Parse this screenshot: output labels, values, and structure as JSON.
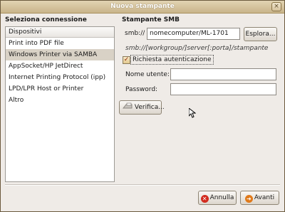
{
  "window": {
    "title": "Nuova stampante",
    "close_glyph": "×"
  },
  "left": {
    "heading": "Seleziona connessione",
    "list_header": "Dispositivi",
    "items": [
      "Print into PDF file",
      "Windows Printer via SAMBA",
      "AppSocket/HP JetDirect",
      "Internet Printing Protocol (ipp)",
      "LPD/LPR Host or Printer",
      "Altro"
    ],
    "selected_index": 1
  },
  "right": {
    "heading": "Stampante SMB",
    "smb_label": "smb://",
    "smb_value": "nomecomputer/ML-1701",
    "browse_label": "Esplora...",
    "hint": "smb://[workgroup/]server[:porta]/stampante",
    "auth_checkbox_label": "Richiesta autenticazione",
    "auth_checked": true,
    "username_label": "Nome utente:",
    "username_value": "",
    "password_label": "Password:",
    "password_value": "",
    "verify_label": "Verifica..."
  },
  "footer": {
    "cancel_label": "Annulla",
    "forward_label": "Avanti"
  },
  "colors": {
    "title_bar": "#c9b48a",
    "selection": "#d9d2c6",
    "cancel_icon": "#d22b1f",
    "forward_icon": "#e07a1b"
  },
  "icons": {
    "close": "close-icon",
    "verify": "printer-icon",
    "cancel": "cancel-icon",
    "forward": "forward-arrow-icon",
    "check": "check-icon",
    "cursor": "mouse-pointer-icon"
  }
}
